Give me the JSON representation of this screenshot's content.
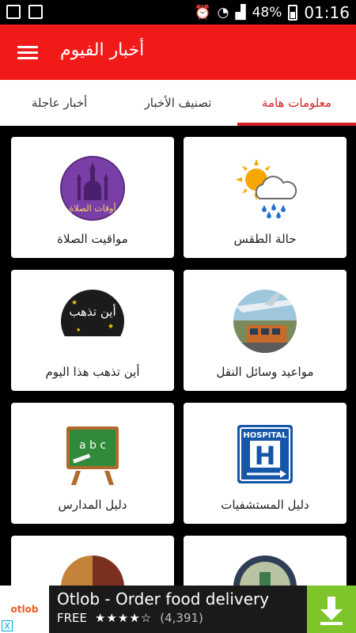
{
  "status_bar": {
    "battery": "48%",
    "time": "01:16"
  },
  "app_bar": {
    "title": "أخبار الفيوم",
    "color": "#f21919"
  },
  "tabs": [
    {
      "label": "أخبار عاجلة",
      "selected": false
    },
    {
      "label": "تصنيف الأخبار",
      "selected": false
    },
    {
      "label": "معلومات هامة",
      "selected": true
    }
  ],
  "cards": [
    {
      "label": "حالة الطقس",
      "icon": "weather-icon"
    },
    {
      "label": "مواقيت الصلاة",
      "icon": "prayer-times-icon"
    },
    {
      "label": "مواعيد وسائل النقل",
      "icon": "transport-icon"
    },
    {
      "label": "أين تذهب هذا اليوم",
      "icon": "where-to-go-icon"
    },
    {
      "label": "دليل المستشفيات",
      "icon": "hospital-icon"
    },
    {
      "label": "دليل المدارس",
      "icon": "school-icon"
    },
    {
      "label": "",
      "icon": "partial-icon-1"
    },
    {
      "label": "",
      "icon": "partial-icon-2"
    }
  ],
  "icon_text": {
    "prayer_caption": "أوقات الصلاة",
    "where_caption": "أين تذهب",
    "hospital_sign": "HOSPITAL",
    "hospital_letter": "H",
    "school_letters": "a b c"
  },
  "ad": {
    "logo_text": "otlob",
    "title": "Otlob - Order food delivery",
    "free_label": "FREE",
    "stars": "★★★★☆",
    "rating_count": "(4,391)",
    "close_glyph": "X"
  },
  "colors": {
    "accent": "#d71f24",
    "tab_bg": "#ffffff",
    "grid_bg": "#000000",
    "ad_download": "#7dc52b"
  }
}
